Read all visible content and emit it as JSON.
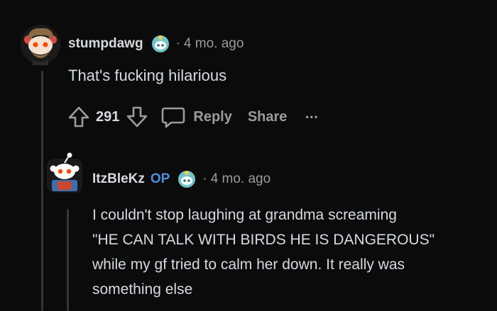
{
  "comment1": {
    "username": "stumpdawg",
    "dot": "·",
    "age": "4 mo. ago",
    "text": "That's fucking hilarious",
    "score": "291",
    "reply_label": "Reply",
    "share_label": "Share",
    "more_label": "•••"
  },
  "comment2": {
    "username": "ItzBleKz",
    "op_badge": "OP",
    "dot": "·",
    "age": "4 mo. ago",
    "text_lines": [
      "I couldn't stop laughing at grandma screaming",
      "\"HE CAN TALK WITH BIRDS HE IS DANGEROUS\"",
      "while my gf tried to calm her down. It really was",
      "something else"
    ]
  },
  "colors": {
    "background": "#0b0b0b",
    "op": "#4a90e2",
    "muted": "#9b9b9b",
    "text": "#d7dadc"
  },
  "icons": [
    "upvote-icon",
    "downvote-icon",
    "comment-icon",
    "more-icon",
    "award-icon"
  ]
}
